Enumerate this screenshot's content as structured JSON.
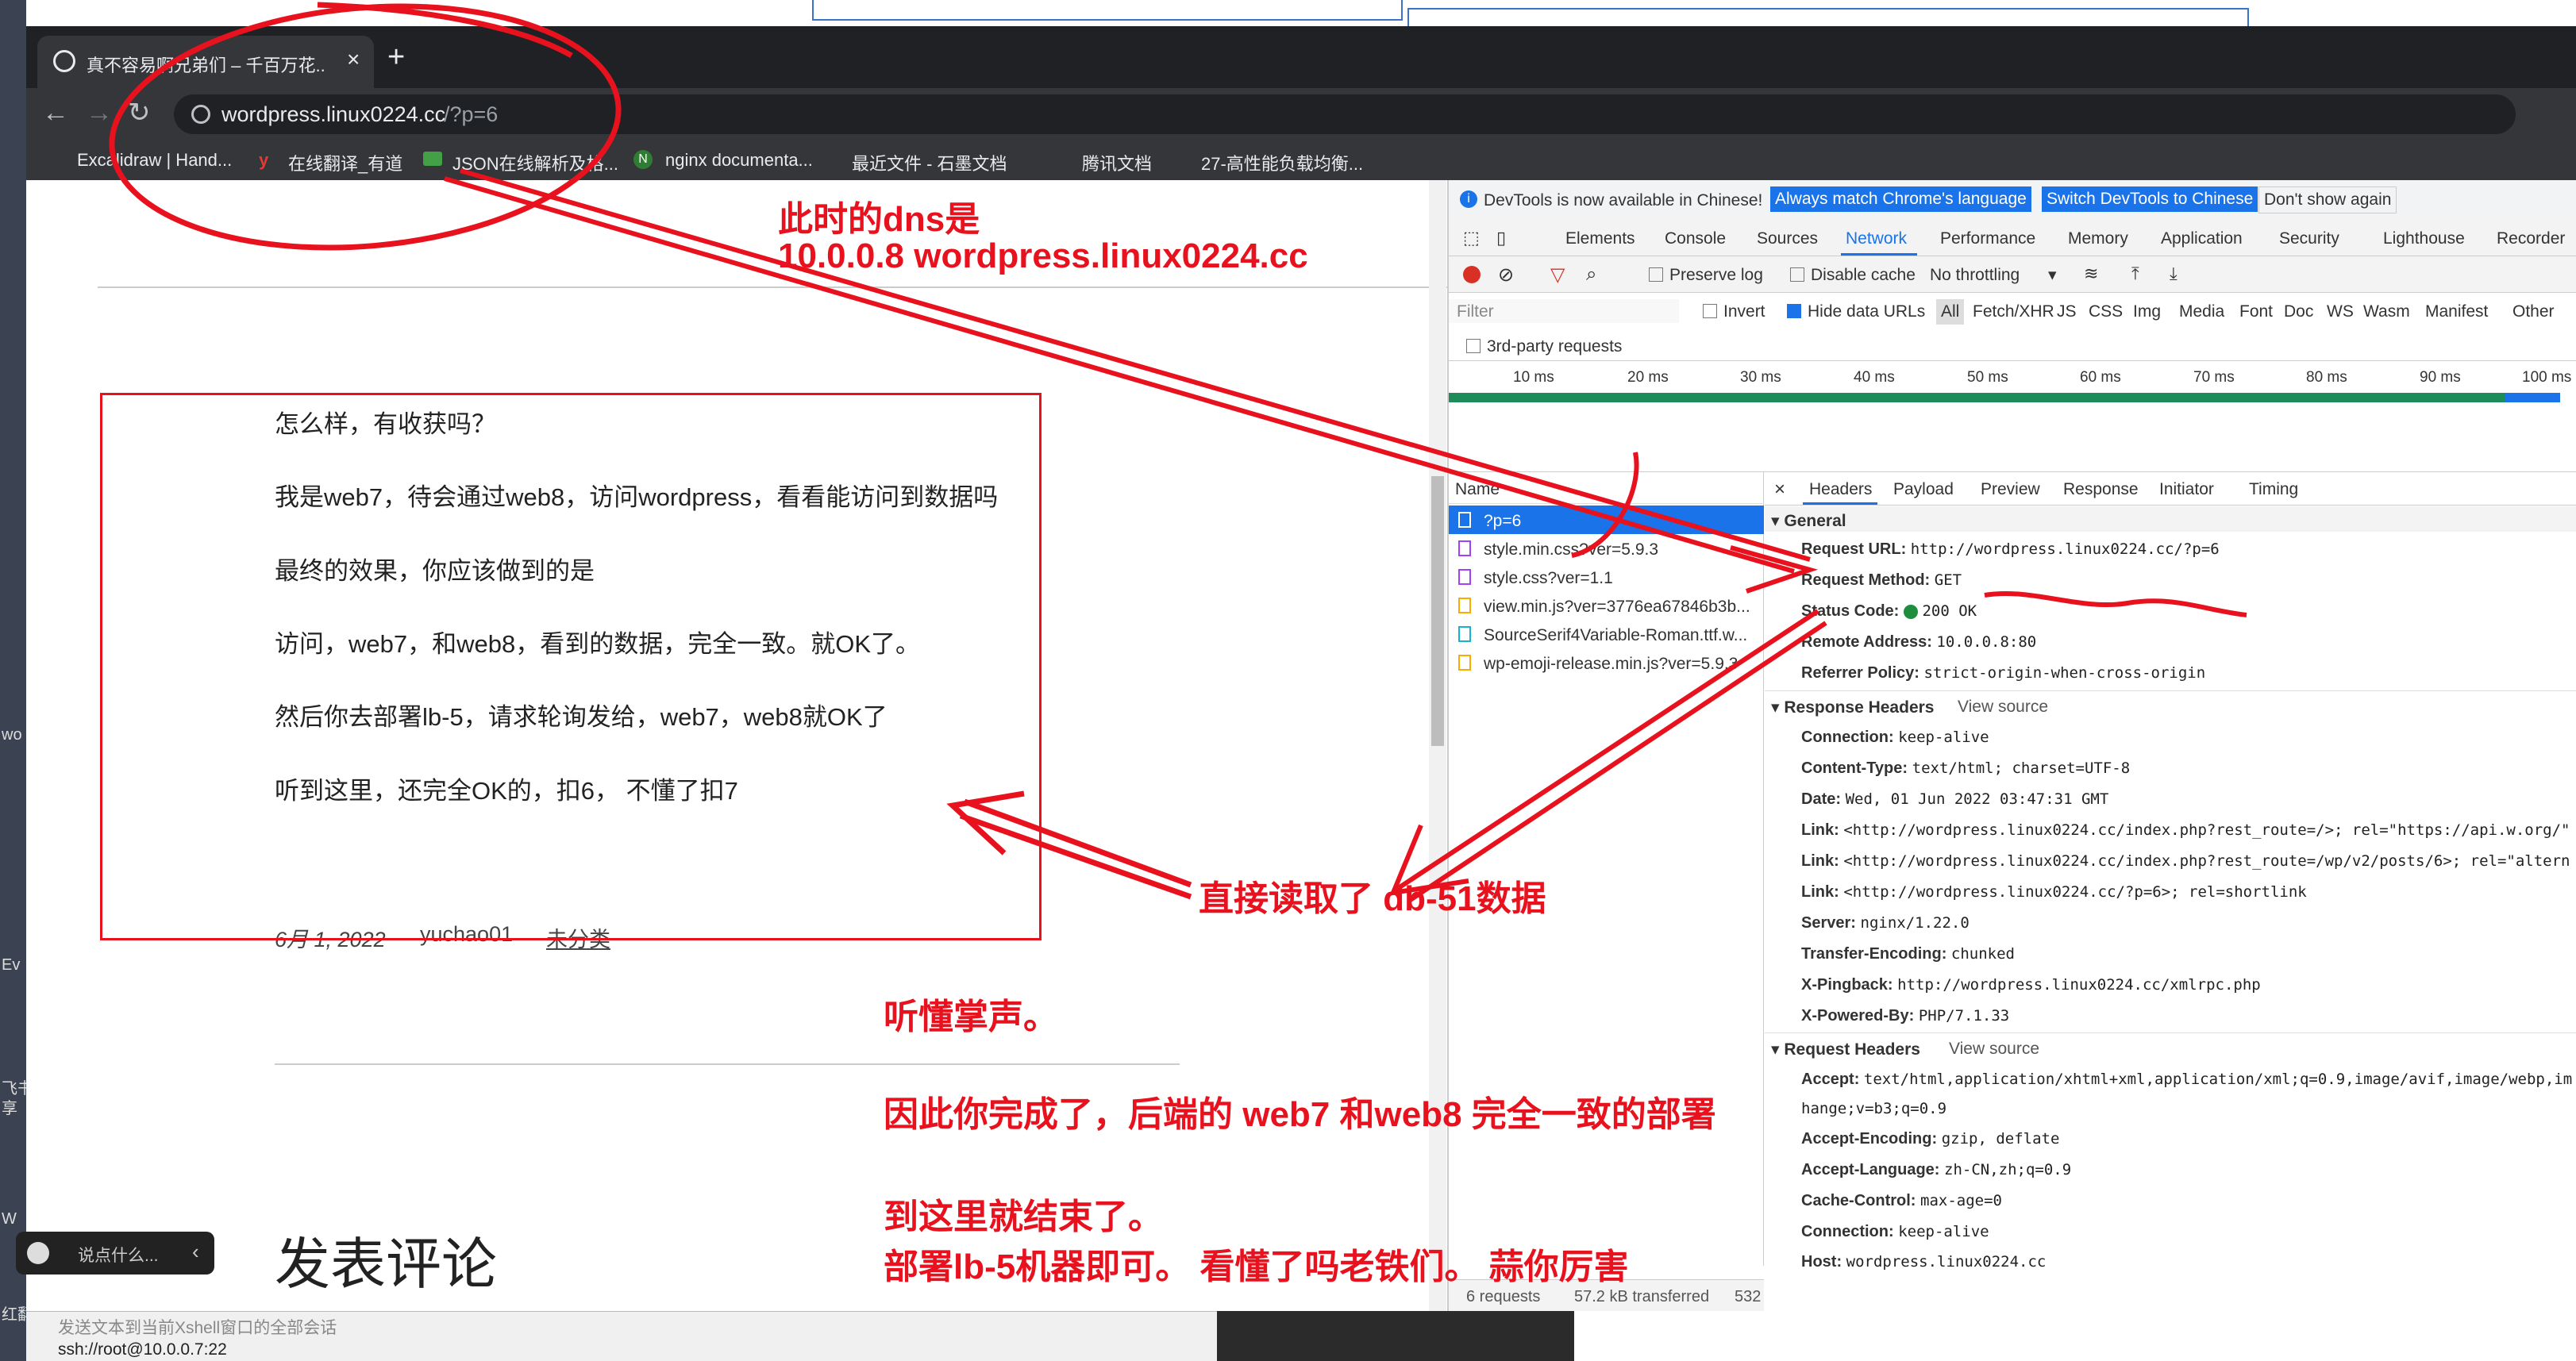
{
  "desktop": {
    "labels": [
      "wo",
      "Ev",
      "飞书",
      "享",
      "W",
      "红翻"
    ]
  },
  "browser": {
    "tab": {
      "title": "真不容易啊兄弟们 – 千百万花..",
      "close": "×",
      "new": "+"
    },
    "address": "wordpress.linux0224.cc",
    "address_path": "/?p=6",
    "bookmarks": [
      "Excalidraw | Hand...",
      "在线翻译_有道",
      "JSON在线解析及格...",
      "nginx documenta...",
      "最近文件 - 石墨文档",
      "腾讯文档",
      "27-高性能负载均衡..."
    ]
  },
  "post": {
    "paragraphs": [
      "怎么样，有收获吗？",
      "我是web7，待会通过web8，访问wordpress，看看能访问到数据吗",
      "最终的效果，你应该做到的是",
      "访问，web7，和web8，看到的数据，完全一致。就OK了。",
      "然后你去部署lb-5，请求轮询发给，web7，web8就OK了",
      "听到这里，还完全OK的，扣6， 不懂了扣7"
    ],
    "date": "6月 1, 2022",
    "author": "yuchao01",
    "category": "未分类",
    "comments_title": "发表评论"
  },
  "chat_widget": {
    "placeholder": "说点什么..."
  },
  "devtools": {
    "banner": {
      "text": "DevTools is now available in Chinese!",
      "btn1": "Always match Chrome's language",
      "btn2": "Switch DevTools to Chinese",
      "btn3": "Don't show again"
    },
    "tabs": [
      "Elements",
      "Console",
      "Sources",
      "Network",
      "Performance",
      "Memory",
      "Application",
      "Security",
      "Lighthouse",
      "Recorder"
    ],
    "active_tab": "Network",
    "controls": {
      "preserve": "Preserve log",
      "disable_cache": "Disable cache",
      "throttle": "No throttling"
    },
    "filter": {
      "placeholder": "Filter",
      "invert": "Invert",
      "hide_data": "Hide data URLs",
      "types": [
        "All",
        "Fetch/XHR",
        "JS",
        "CSS",
        "Img",
        "Media",
        "Font",
        "Doc",
        "WS",
        "Wasm",
        "Manifest",
        "Other"
      ],
      "third_party": "3rd-party requests"
    },
    "timeline": [
      "10 ms",
      "20 ms",
      "30 ms",
      "40 ms",
      "50 ms",
      "60 ms",
      "70 ms",
      "80 ms",
      "90 ms",
      "100 ms"
    ],
    "name_header": "Name",
    "requests": [
      "?p=6",
      "style.min.css?ver=5.9.3",
      "style.css?ver=1.1",
      "view.min.js?ver=3776ea67846b3b...",
      "SourceSerif4Variable-Roman.ttf.w...",
      "wp-emoji-release.min.js?ver=5.9.3"
    ],
    "detail_tabs": [
      "Headers",
      "Payload",
      "Preview",
      "Response",
      "Initiator",
      "Timing"
    ],
    "general": {
      "title": "General",
      "rows": [
        [
          "Request URL:",
          "http://wordpress.linux0224.cc/?p=6"
        ],
        [
          "Request Method:",
          "GET"
        ],
        [
          "Status Code:",
          "200 OK"
        ],
        [
          "Remote Address:",
          "10.0.0.8:80"
        ],
        [
          "Referrer Policy:",
          "strict-origin-when-cross-origin"
        ]
      ]
    },
    "response_headers": {
      "title": "Response Headers",
      "view": "View source",
      "rows": [
        [
          "Connection:",
          "keep-alive"
        ],
        [
          "Content-Type:",
          "text/html; charset=UTF-8"
        ],
        [
          "Date:",
          "Wed, 01 Jun 2022 03:47:31 GMT"
        ],
        [
          "Link:",
          "<http://wordpress.linux0224.cc/index.php?rest_route=/>; rel=\"https://api.w.org/\""
        ],
        [
          "Link:",
          "<http://wordpress.linux0224.cc/index.php?rest_route=/wp/v2/posts/6>; rel=\"altern"
        ],
        [
          "Link:",
          "<http://wordpress.linux0224.cc/?p=6>; rel=shortlink"
        ],
        [
          "Server:",
          "nginx/1.22.0"
        ],
        [
          "Transfer-Encoding:",
          "chunked"
        ],
        [
          "X-Pingback:",
          "http://wordpress.linux0224.cc/xmlrpc.php"
        ],
        [
          "X-Powered-By:",
          "PHP/7.1.33"
        ]
      ]
    },
    "request_headers": {
      "title": "Request Headers",
      "view": "View source",
      "rows": [
        [
          "Accept:",
          "text/html,application/xhtml+xml,application/xml;q=0.9,image/avif,image/webp,im"
        ],
        [
          "",
          "hange;v=b3;q=0.9"
        ],
        [
          "Accept-Encoding:",
          "gzip, deflate"
        ],
        [
          "Accept-Language:",
          "zh-CN,zh;q=0.9"
        ],
        [
          "Cache-Control:",
          "max-age=0"
        ],
        [
          "Connection:",
          "keep-alive"
        ],
        [
          "Host:",
          "wordpress.linux0224.cc"
        ]
      ]
    },
    "status": {
      "requests": "6 requests",
      "transferred": "57.2 kB transferred",
      "extra": "532"
    }
  },
  "annotations": {
    "dns1": "此时的dns是",
    "dns2": "10.0.0.8  wordpress.linux0224.cc",
    "read": "直接读取了 db-51数据",
    "clap": "听懂掌声。",
    "done": "因此你完成了，后端的 web7 和web8 完全一致的部署",
    "end": "到这里就结束了。",
    "lb": "部署lb-5机器即可。 看懂了吗老铁们。 蒜你厉害"
  },
  "terminal": {
    "hint": "发送文本到当前Xshell窗口的全部会话",
    "session": "ssh://root@10.0.0.7:22"
  },
  "colors": {
    "annotation": "#e8121e",
    "devtools_accent": "#1a73e8",
    "selected_row": "#1a73e8"
  }
}
